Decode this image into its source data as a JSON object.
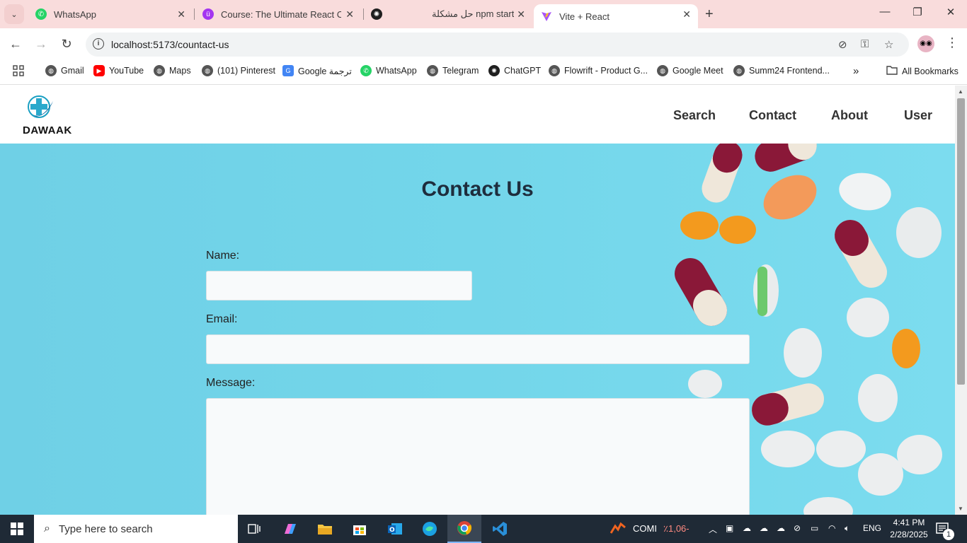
{
  "browser": {
    "tabs": [
      {
        "title": "WhatsApp",
        "active": false
      },
      {
        "title": "Course: The Ultimate React Cou",
        "active": false
      },
      {
        "title": "",
        "active": false
      },
      {
        "title": "حل مشكلة npm start",
        "active": false
      },
      {
        "title": "Vite + React",
        "active": true
      }
    ],
    "url": "localhost:5173/countact-us",
    "bookmarks": [
      "Gmail",
      "YouTube",
      "Maps",
      "(101) Pinterest",
      "Google ترجمة",
      "WhatsApp",
      "Telegram",
      "ChatGPT",
      "Flowrift - Product G...",
      "Google Meet",
      "Summ24 Frontend...",
      "All Bookmarks"
    ]
  },
  "site": {
    "brand": "DAWAAK",
    "nav": [
      "Search",
      "Contact",
      "About",
      "User"
    ],
    "contact": {
      "title": "Contact Us",
      "name_label": "Name:",
      "name_value": "",
      "email_label": "Email:",
      "email_value": "",
      "message_label": "Message:",
      "message_value": ""
    },
    "colors": {
      "hero_bg": "#73d6ea",
      "title_text": "#1e2d3d",
      "header_bg": "#ffffff"
    }
  },
  "taskbar": {
    "search_placeholder": "Type here to search",
    "stock_ticker": "COMI",
    "stock_change": "٪1,06-",
    "language": "ENG",
    "time": "4:41 PM",
    "date": "2/28/2025",
    "notification_count": "1"
  }
}
